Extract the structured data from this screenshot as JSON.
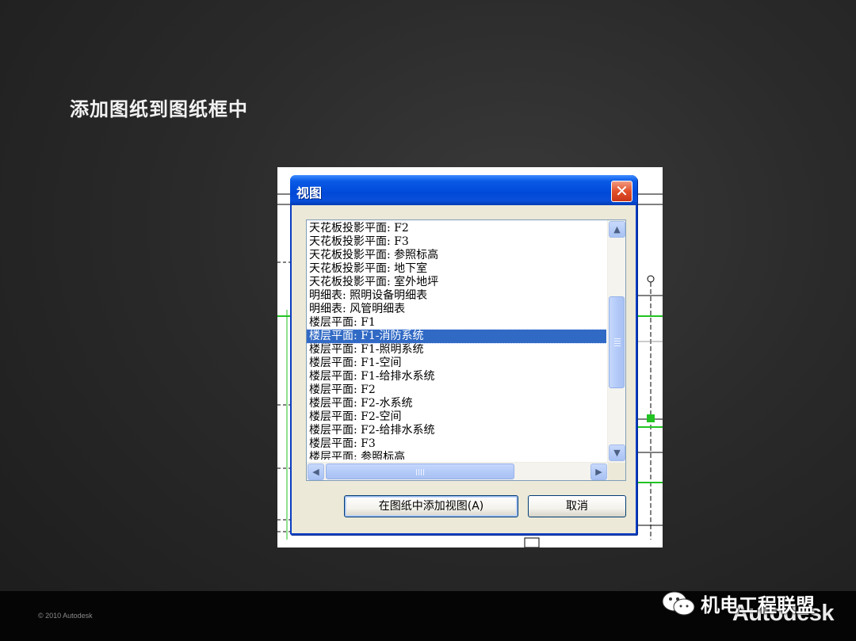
{
  "slide": {
    "title": "添加图纸到图纸框中",
    "copyright": "© 2010 Autodesk",
    "brand": "Autodesk",
    "watermark_text": "机电工程联盟",
    "watermark_icon": "wechat-icon"
  },
  "dialog": {
    "title": "视图",
    "close_icon": "close-icon",
    "views": [
      "天花板投影平面: F2",
      "天花板投影平面: F3",
      "天花板投影平面: 参照标高",
      "天花板投影平面: 地下室",
      "天花板投影平面: 室外地坪",
      "明细表: 照明设备明细表",
      "明细表: 风管明细表",
      "楼层平面: F1",
      "楼层平面: F1-消防系统",
      "楼层平面: F1-照明系统",
      "楼层平面: F1-空间",
      "楼层平面: F1-给排水系统",
      "楼层平面: F2",
      "楼层平面: F2-水系统",
      "楼层平面: F2-空间",
      "楼层平面: F2-给排水系统",
      "楼层平面: F3",
      "楼层平面: 参照标高"
    ],
    "selected_index": 8,
    "add_button": "在图纸中添加视图(A)",
    "cancel_button": "取消",
    "colors": {
      "titlebar": "#0a5ae6",
      "selection": "#316ac5",
      "close": "#e2502a"
    }
  }
}
